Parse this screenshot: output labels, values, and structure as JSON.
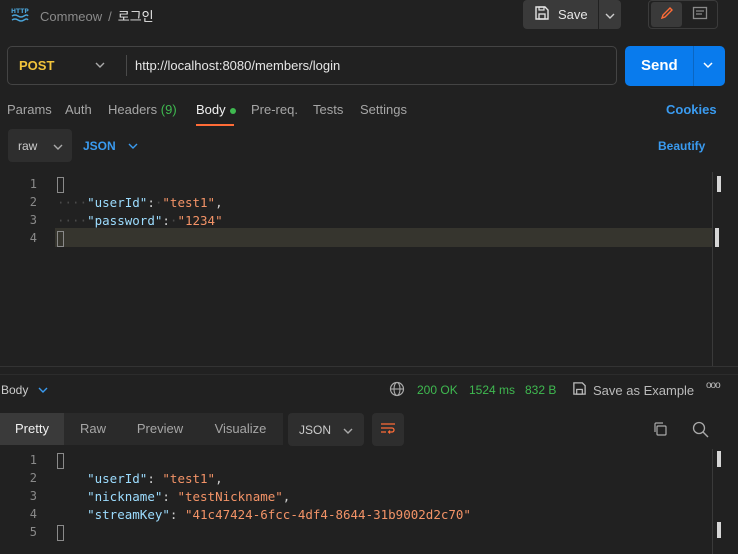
{
  "header": {
    "collection": "Commeow",
    "separator": "/",
    "request_name": "로그인",
    "save_label": "Save"
  },
  "request": {
    "method": "POST",
    "url": "http://localhost:8080/members/login",
    "send_label": "Send"
  },
  "tabs": {
    "params": "Params",
    "auth": "Auth",
    "headers": "Headers",
    "headers_count": "(9)",
    "body": "Body",
    "prereq": "Pre-req.",
    "tests": "Tests",
    "settings": "Settings",
    "cookies": "Cookies"
  },
  "body_options": {
    "mode": "raw",
    "language": "JSON",
    "beautify": "Beautify"
  },
  "request_body": {
    "line_numbers": [
      "1",
      "2",
      "3",
      "4"
    ],
    "lines": [
      {
        "key": "\"userId\"",
        "value": "\"test1\"",
        "comma": ","
      },
      {
        "key": "\"password\"",
        "value": "\"1234\"",
        "comma": ""
      }
    ]
  },
  "response": {
    "label": "Body",
    "status": "200 OK",
    "time": "1524 ms",
    "size": "832 B",
    "save_example": "Save as Example",
    "more": "ooo",
    "view_tabs": [
      "Pretty",
      "Raw",
      "Preview",
      "Visualize"
    ],
    "format": "JSON",
    "line_numbers": [
      "1",
      "2",
      "3",
      "4",
      "5"
    ],
    "lines": [
      {
        "key": "\"userId\"",
        "value": "\"test1\"",
        "comma": ","
      },
      {
        "key": "\"nickname\"",
        "value": "\"testNickname\"",
        "comma": ","
      },
      {
        "key": "\"streamKey\"",
        "value": "\"41c47424-6fcc-4df4-8644-31b9002d2c70\"",
        "comma": ""
      }
    ]
  },
  "colors": {
    "accent_send": "#097bed",
    "method_post": "#f2c43b",
    "status_ok": "#3fb950",
    "active_tab_underline": "#ff6c37",
    "json_key": "#9cdcfe",
    "json_string": "#f39367"
  },
  "icons": [
    "http-icon",
    "save-icon",
    "chevron-down-icon",
    "pencil-icon",
    "document-icon",
    "globe-icon",
    "copy-icon",
    "search-icon",
    "wrap-lines-icon"
  ]
}
